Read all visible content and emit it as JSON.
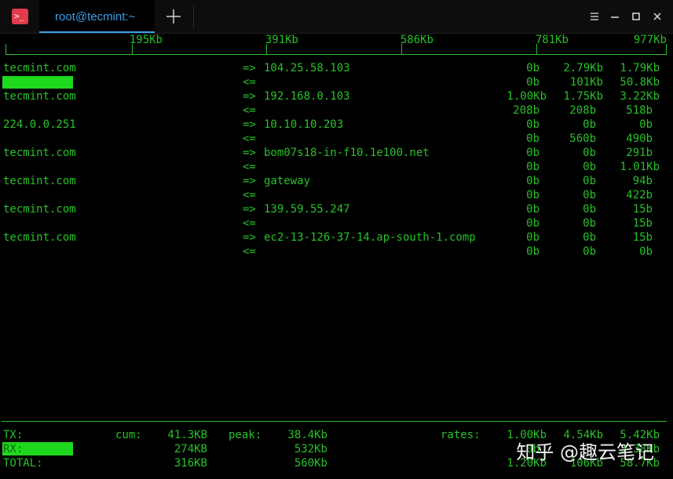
{
  "window": {
    "tab_title": "root@tecmint:~",
    "app_icon_glyph": ">_",
    "accent_color": "#3a9fe8",
    "icon_color": "#e23c4b"
  },
  "scale": {
    "labels": [
      "195Kb",
      "391Kb",
      "586Kb",
      "781Kb",
      "977Kb"
    ]
  },
  "connections": [
    {
      "host": "tecmint.com",
      "dest": "104.25.58.103",
      "tx": [
        "0b",
        "2.79Kb",
        "1.79Kb"
      ],
      "rx": [
        "0b",
        "101Kb",
        "50.8Kb"
      ]
    },
    {
      "host": "tecmint.com",
      "dest": "192.168.0.103",
      "tx": [
        "1.00Kb",
        "1.75Kb",
        "3.22Kb"
      ],
      "rx": [
        "208b",
        "208b",
        "518b"
      ]
    },
    {
      "host": "224.0.0.251",
      "dest": "10.10.10.203",
      "tx": [
        "0b",
        "0b",
        "0b"
      ],
      "rx": [
        "0b",
        "560b",
        "490b"
      ]
    },
    {
      "host": "tecmint.com",
      "dest": "bom07s18-in-f10.1e100.net",
      "tx": [
        "0b",
        "0b",
        "291b"
      ],
      "rx": [
        "0b",
        "0b",
        "1.01Kb"
      ]
    },
    {
      "host": "tecmint.com",
      "dest": "gateway",
      "tx": [
        "0b",
        "0b",
        "94b"
      ],
      "rx": [
        "0b",
        "0b",
        "422b"
      ]
    },
    {
      "host": "tecmint.com",
      "dest": "139.59.55.247",
      "tx": [
        "0b",
        "0b",
        "15b"
      ],
      "rx": [
        "0b",
        "0b",
        "15b"
      ]
    },
    {
      "host": "tecmint.com",
      "dest": "ec2-13-126-37-14.ap-south-1.comp",
      "tx": [
        "0b",
        "0b",
        "15b"
      ],
      "rx": [
        "0b",
        "0b",
        "0b"
      ]
    }
  ],
  "arrows": {
    "out": "=>",
    "in": "<="
  },
  "totals": {
    "tx_label": "TX:",
    "rx_label": "RX:",
    "total_label": "TOTAL:",
    "cum_label": "cum:",
    "peak_label": "peak:",
    "rates_label": "rates:",
    "tx_cum": "41.3KB",
    "rx_cum": "274KB",
    "total_cum": "316KB",
    "tx_peak": "38.4Kb",
    "rx_peak": "532Kb",
    "total_peak": "560Kb",
    "tx_rates": [
      "1.00Kb",
      "4.54Kb",
      "5.42Kb"
    ],
    "rx_rates": [
      "0b",
      "",
      "3.38Kb"
    ],
    "total_rates": [
      "1.20Kb",
      "106Kb",
      "58.7Kb"
    ]
  },
  "watermark": "知乎 @趣云笔记",
  "text_color": "#27c227",
  "bar_color": "#1ed81e"
}
